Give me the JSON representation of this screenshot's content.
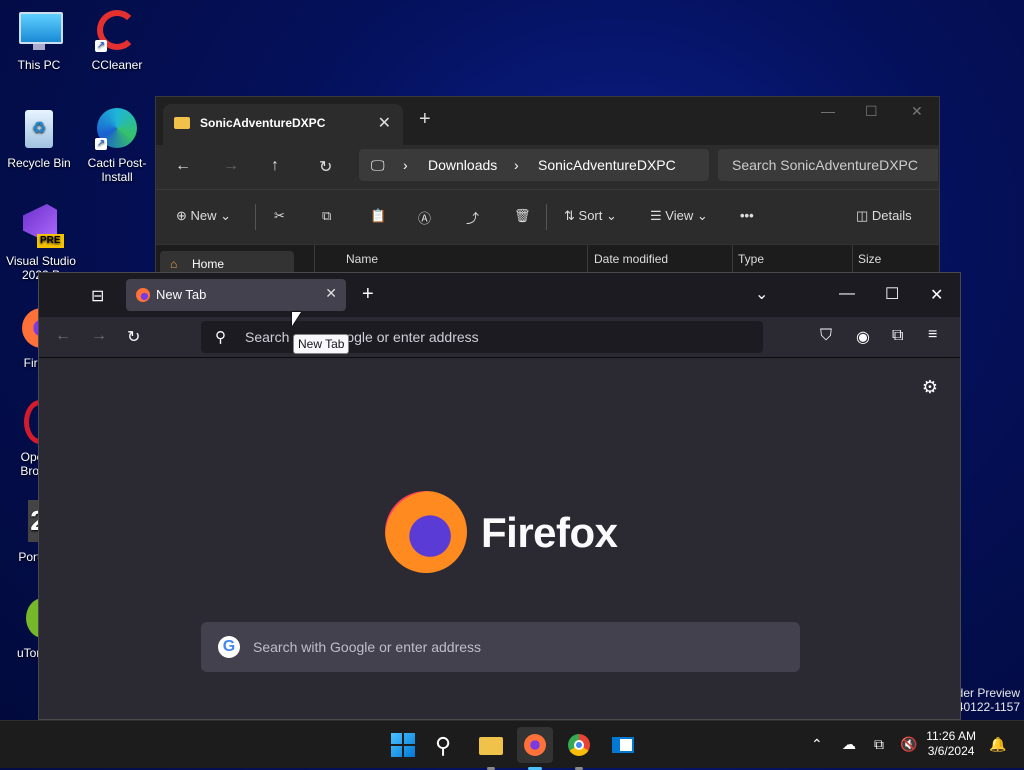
{
  "desktop": {
    "icons": [
      {
        "label": "This PC"
      },
      {
        "label": "CCleaner"
      },
      {
        "label": "Recycle Bin"
      },
      {
        "label": "Cacti Post-Install"
      },
      {
        "label": "Visual Studio 2022 P",
        "badge": "PRE"
      },
      {
        "label": "Fire"
      },
      {
        "label": "Oper Brow"
      },
      {
        "label": "Portal"
      },
      {
        "label": "uTorre"
      }
    ],
    "watermark_line1": "der Preview",
    "watermark_line2": "40122-1157"
  },
  "explorer": {
    "tab_title": "SonicAdventureDXPC",
    "breadcrumb": [
      "Downloads",
      "SonicAdventureDXPC"
    ],
    "search_placeholder": "Search SonicAdventureDXPC",
    "commands": {
      "new": "New",
      "sort": "Sort",
      "view": "View",
      "details": "Details"
    },
    "sidebar_home": "Home",
    "columns": [
      "Name",
      "Date modified",
      "Type",
      "Size"
    ]
  },
  "firefox": {
    "tab_title": "New Tab",
    "url_placeholder": "Search or enter address",
    "url_visible_left": "Search",
    "url_visible_right": "ogle or enter address",
    "tooltip": "New Tab",
    "brand": "Firefox",
    "search_placeholder": "Search with Google or enter address",
    "google_glyph": "G"
  },
  "taskbar": {
    "time": "11:26 AM",
    "date": "3/6/2024"
  },
  "colors": {
    "firefox_bg": "#2b2a33",
    "explorer_bg": "#1c1c1c",
    "taskbar": "#1c1c1c",
    "accent": "#0078d4"
  }
}
